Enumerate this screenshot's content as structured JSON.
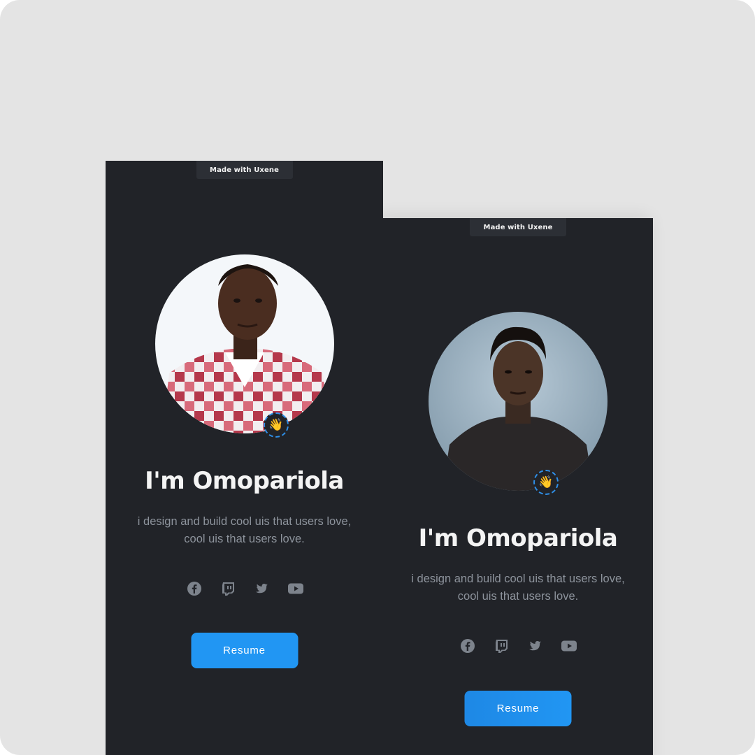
{
  "colors": {
    "page_background": "#e4e4e4",
    "card_background": "#212328",
    "accent": "#2196f3",
    "text_primary": "#f4f4f4",
    "text_muted": "#8d939c"
  },
  "cards": [
    {
      "badge": "Made with Uxene",
      "avatar_icon": "portrait-photo",
      "wave_emoji": "👋",
      "name": "I'm Omopariola",
      "bio_line1": "i design and build cool uis that users love,",
      "bio_line2": "cool uis that users love.",
      "socials": [
        "facebook-icon",
        "twitch-icon",
        "twitter-icon",
        "youtube-icon"
      ],
      "button_label": "Resume"
    },
    {
      "badge": "Made with Uxene",
      "avatar_icon": "portrait-photo",
      "wave_emoji": "👋",
      "name": "I'm Omopariola",
      "bio_line1": "i design and build cool uis that users love,",
      "bio_line2": "cool uis that users love.",
      "socials": [
        "facebook-icon",
        "twitch-icon",
        "twitter-icon",
        "youtube-icon"
      ],
      "button_label": "Resume"
    }
  ]
}
